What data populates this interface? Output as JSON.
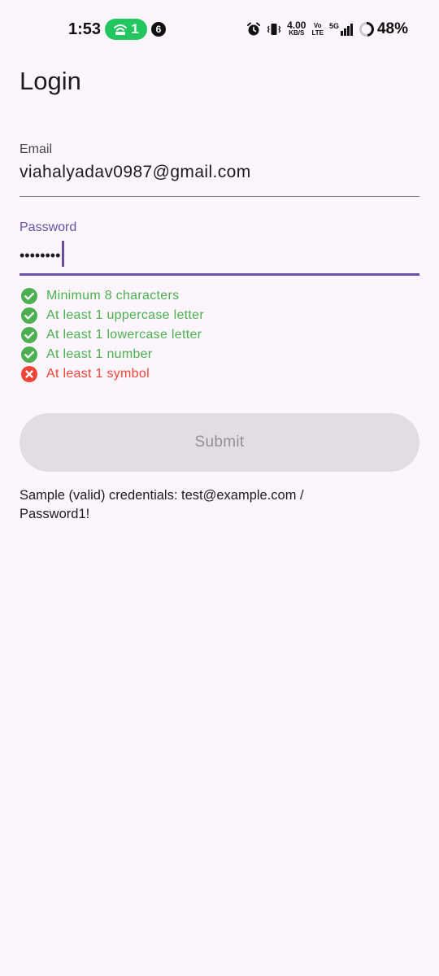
{
  "status_bar": {
    "time": "1:53",
    "hotspot_count": "1",
    "notification_count": "6",
    "net_speed_value": "4.00",
    "net_speed_unit": "KB/S",
    "volte_top": "Vo",
    "volte_bottom": "LTE",
    "network_type": "5G",
    "battery_percent": "48%"
  },
  "page": {
    "title": "Login"
  },
  "email": {
    "label": "Email",
    "value": "viahalyadav0987@gmail.com"
  },
  "password": {
    "label": "Password",
    "masked_value": "••••••••"
  },
  "rules": [
    {
      "text": "Minimum 8 characters",
      "met": true
    },
    {
      "text": "At least 1 uppercase letter",
      "met": true
    },
    {
      "text": "At least 1 lowercase letter",
      "met": true
    },
    {
      "text": "At least 1 number",
      "met": true
    },
    {
      "text": "At least 1 symbol",
      "met": false
    }
  ],
  "submit": {
    "label": "Submit",
    "enabled": false
  },
  "hint": "Sample (valid) credentials: test@example.com / Password1!",
  "colors": {
    "background": "#fcf6fc",
    "accent": "#6750a4",
    "success": "#4caf50",
    "error": "#f44336",
    "hotspot": "#22c55e",
    "button_disabled_bg": "#e3dde3",
    "button_disabled_text": "#938f96"
  },
  "icons": {
    "hotspot": "hotspot-icon",
    "alarm": "alarm-icon",
    "vibrate": "vibrate-icon",
    "signal": "signal-icon",
    "battery": "battery-icon",
    "rule_met": "check-circle-icon",
    "rule_unmet": "error-circle-icon"
  }
}
